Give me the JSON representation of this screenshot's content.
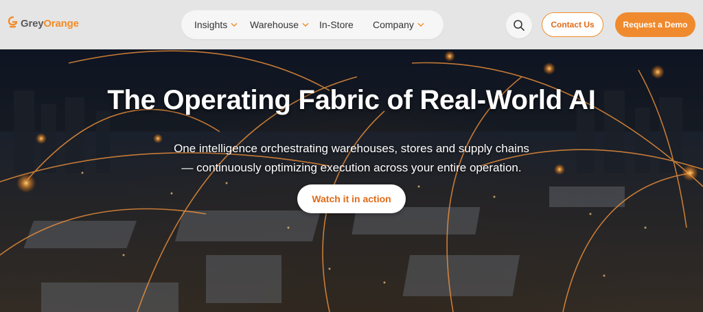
{
  "header": {
    "logo": {
      "part1": "Grey",
      "part2": "Orange"
    },
    "nav": [
      {
        "label": "Insights",
        "has_dropdown": true
      },
      {
        "label": "Warehouse",
        "has_dropdown": true
      },
      {
        "label": "In-Store",
        "has_dropdown": false
      },
      {
        "label": "Company",
        "has_dropdown": true
      }
    ],
    "search_icon": "search-icon",
    "contact_label": "Contact Us",
    "demo_label": "Request a Demo"
  },
  "hero": {
    "title": "The Operating Fabric of Real-World AI",
    "subtitle_line1": "One intelligence orchestrating warehouses, stores and supply chains",
    "subtitle_line2": "— continuously optimizing execution across your entire operation.",
    "cta_label": "Watch it in action"
  },
  "colors": {
    "brand_orange": "#f28c28",
    "brand_grey": "#5a5a5a",
    "header_bg": "#e5e5e5",
    "demo_button_bg": "#f08a2e"
  }
}
